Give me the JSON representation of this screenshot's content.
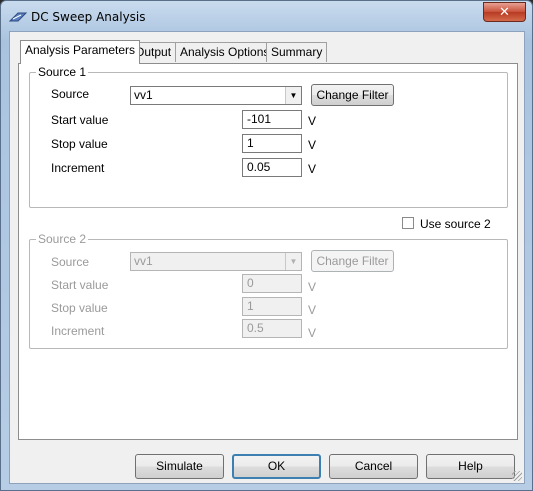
{
  "window": {
    "title": "DC Sweep Analysis",
    "close_glyph": "✕"
  },
  "tabs": [
    {
      "label": "Analysis Parameters",
      "active": true
    },
    {
      "label": "Output",
      "active": false
    },
    {
      "label": "Analysis Options",
      "active": false
    },
    {
      "label": "Summary",
      "active": false
    }
  ],
  "source1": {
    "legend": "Source 1",
    "source_label": "Source",
    "source_value": "vv1",
    "change_filter_label": "Change Filter",
    "start_label": "Start value",
    "start_value": "-101",
    "stop_label": "Stop value",
    "stop_value": "1",
    "increment_label": "Increment",
    "increment_value": "0.05",
    "unit": "V"
  },
  "use_source2": {
    "label": "Use source 2",
    "checked": false
  },
  "source2": {
    "legend": "Source 2",
    "source_label": "Source",
    "source_value": "vv1",
    "change_filter_label": "Change Filter",
    "start_label": "Start value",
    "start_value": "0",
    "stop_label": "Stop value",
    "stop_value": "1",
    "increment_label": "Increment",
    "increment_value": "0.5",
    "unit": "V"
  },
  "footer": {
    "simulate_label": "Simulate",
    "ok_label": "OK",
    "cancel_label": "Cancel",
    "help_label": "Help"
  },
  "colors": {
    "accent": "#3c7fb1",
    "close_button": "#c8513a",
    "disabled_text": "#9a9a9a"
  },
  "icons": {
    "app": "dc-sweep-app-icon",
    "dropdown": "chevron-down-icon",
    "close": "close-icon"
  }
}
